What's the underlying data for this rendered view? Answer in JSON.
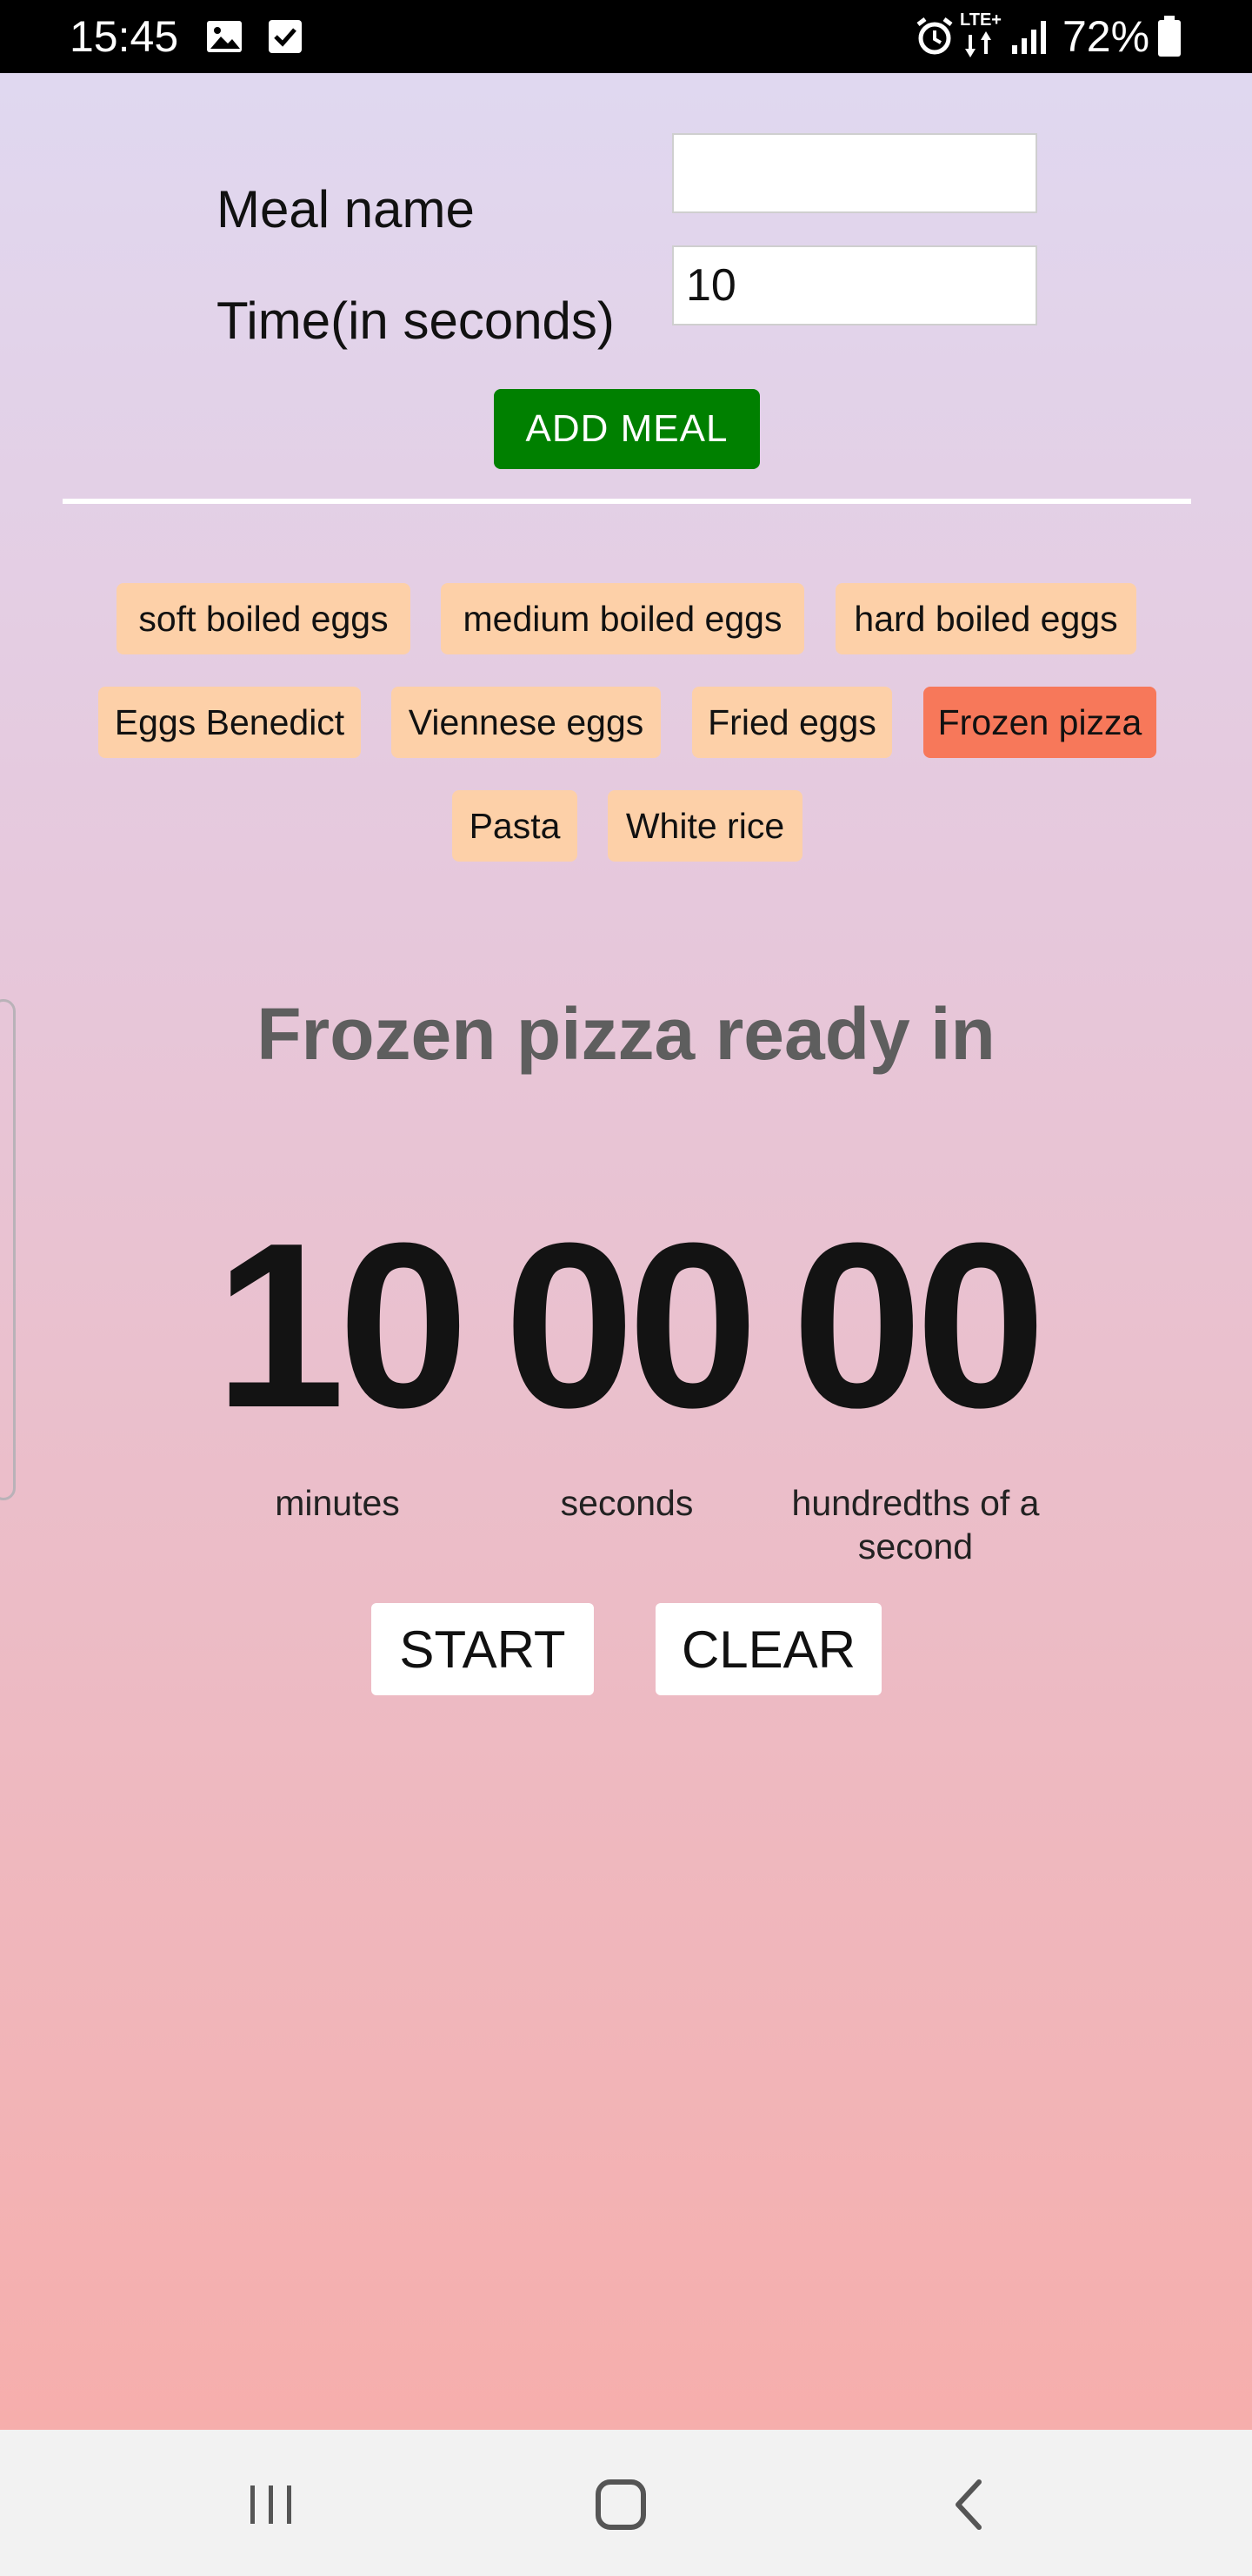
{
  "status_bar": {
    "time": "15:45",
    "network": "LTE+",
    "battery": "72%",
    "icons": [
      "image-icon",
      "checkbox-icon",
      "alarm-icon",
      "data-transfer-icon",
      "signal-icon",
      "battery-icon"
    ]
  },
  "form": {
    "meal_name_label": "Meal name",
    "meal_name_value": "",
    "time_label": "Time(in seconds)",
    "time_value": "10",
    "add_button": "ADD MEAL"
  },
  "meals": [
    "soft boiled eggs",
    "medium boiled eggs",
    "hard boiled eggs",
    "Eggs Benedict",
    "Viennese eggs",
    "Fried eggs",
    "Frozen pizza",
    "Pasta",
    "White rice"
  ],
  "selected_meal": "Frozen pizza",
  "timer": {
    "title": "Frozen pizza ready in",
    "minutes": "10",
    "seconds": "00",
    "hundredths": "00",
    "minutes_label": "minutes",
    "seconds_label": "seconds",
    "hundredths_label": "hundredths of a second"
  },
  "controls": {
    "start": "START",
    "clear": "CLEAR"
  },
  "nav_bar": {
    "icons": [
      "recent-apps-icon",
      "home-icon",
      "back-icon"
    ]
  },
  "colors": {
    "add_button": "#008000",
    "chip": "#fdd0a8",
    "chip_active": "#f7785a",
    "gradient_top": "#e0d8f0",
    "gradient_bottom": "#f6aeac"
  }
}
